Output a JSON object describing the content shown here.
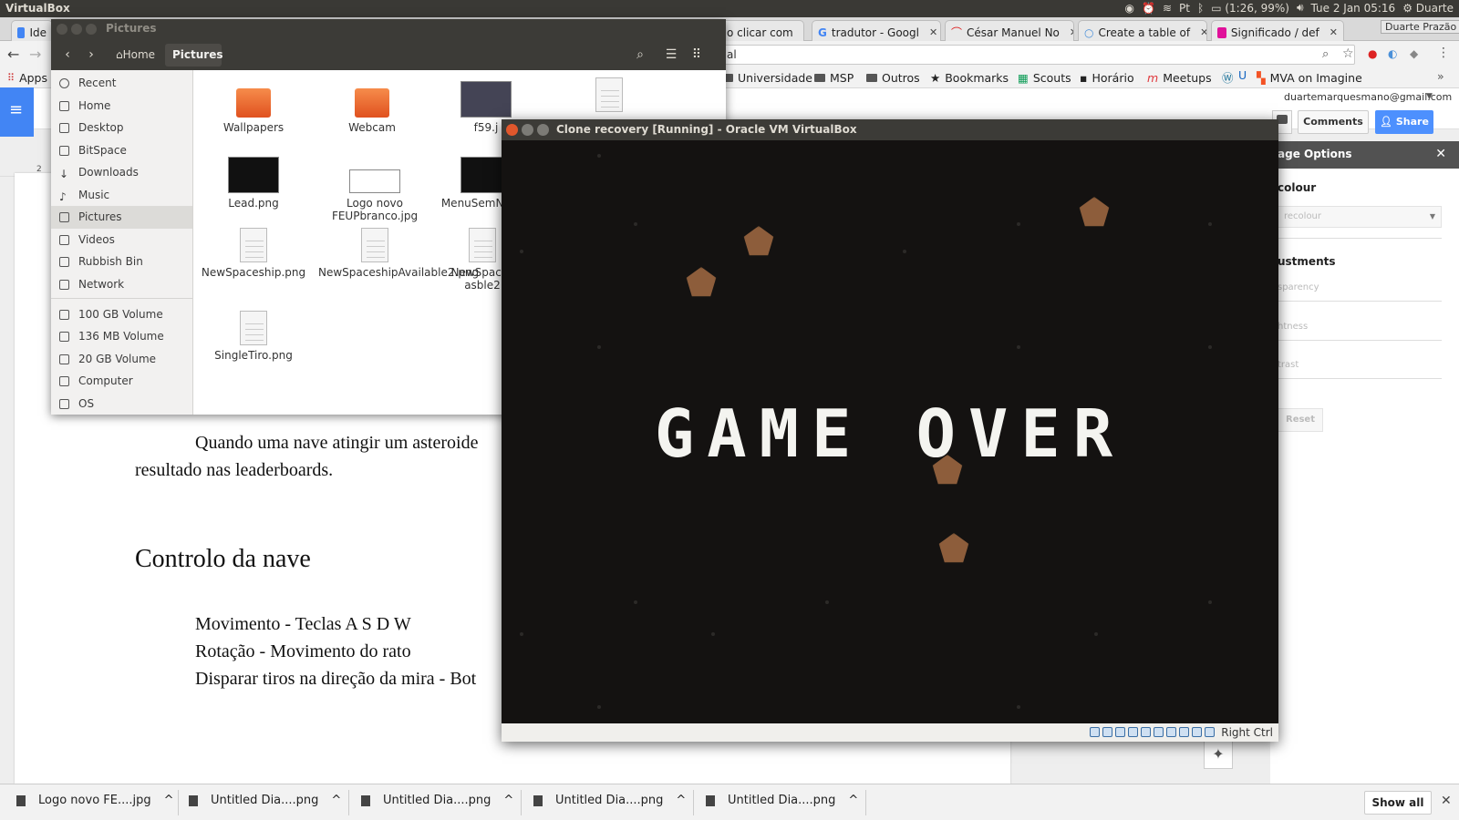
{
  "panel": {
    "app_name": "VirtualBox",
    "battery": "(1:26, 99%)",
    "datetime": "Tue 2 Jan 05:16",
    "user": "Duarte"
  },
  "chrome": {
    "tabs": [
      {
        "label": "Ide"
      },
      {
        "label": "o clicar com"
      },
      {
        "label": "tradutor - Googl"
      },
      {
        "label": "César Manuel No"
      },
      {
        "label": "Create a table of"
      },
      {
        "label": "Significado / def"
      }
    ],
    "profile_name": "Duarte Prazão",
    "omnibox_text": "al",
    "bookmarks": [
      {
        "label": "Apps"
      },
      {
        "label": "Universidade"
      },
      {
        "label": "MSP"
      },
      {
        "label": "Outros"
      },
      {
        "label": "Bookmarks"
      },
      {
        "label": "Scouts"
      },
      {
        "label": "Horário"
      },
      {
        "label": "Meetups"
      },
      {
        "label": "MVA on Imagine"
      }
    ]
  },
  "docs": {
    "user_email": "duartemarquesmano@gmail.com",
    "comments_label": "Comments",
    "share_label": "Share",
    "ruler_mark": "2",
    "body_line1": "Quando uma nave atingir um asteroide",
    "body_line2": "resultado nas leaderboards.",
    "heading": "Controlo da nave",
    "controls": [
      "Movimento - Teclas A S D W",
      "Rotação - Movimento do rato",
      "Disparar tiros na direção da mira - Bot"
    ],
    "image_options": {
      "title": "age Options",
      "recolour_heading": "colour",
      "recolour_select": "recolour",
      "adjustments_heading": "ustments",
      "transparency": "sparency",
      "brightness": "htness",
      "contrast": "trast",
      "reset": "Reset"
    }
  },
  "nautilus": {
    "title": "Pictures",
    "crumb_home": "Home",
    "crumb_current": "Pictures",
    "sidebar": [
      {
        "label": "Recent"
      },
      {
        "label": "Home"
      },
      {
        "label": "Desktop"
      },
      {
        "label": "BitSpace"
      },
      {
        "label": "Downloads"
      },
      {
        "label": "Music"
      },
      {
        "label": "Pictures"
      },
      {
        "label": "Videos"
      },
      {
        "label": "Rubbish Bin"
      },
      {
        "label": "Network"
      },
      {
        "label": "100 GB Volume"
      },
      {
        "label": "136 MB Volume"
      },
      {
        "label": "20 GB Volume"
      },
      {
        "label": "Computer"
      },
      {
        "label": "OS"
      }
    ],
    "files": [
      {
        "name": "Wallpapers"
      },
      {
        "name": "Webcam"
      },
      {
        "name": "f59.j"
      },
      {
        "name": "Lead.png"
      },
      {
        "name": "Logo novo FEUPbranco.jpg"
      },
      {
        "name": "MenuSemN ao.p"
      },
      {
        "name": "NewSpaceship.png"
      },
      {
        "name": "NewSpaceshipAvailable2.png"
      },
      {
        "name": "NewSpaces asble2"
      },
      {
        "name": "SingleTiro.png"
      }
    ]
  },
  "vbox": {
    "title": "Clone recovery [Running] - Oracle VM VirtualBox",
    "game_text": "GAME OVER",
    "host_key": "Right Ctrl"
  },
  "downloads": {
    "items": [
      {
        "name": "Logo novo FE....jpg"
      },
      {
        "name": "Untitled Dia....png"
      },
      {
        "name": "Untitled Dia....png"
      },
      {
        "name": "Untitled Dia....png"
      },
      {
        "name": "Untitled Dia....png"
      }
    ],
    "show_all": "Show all"
  }
}
